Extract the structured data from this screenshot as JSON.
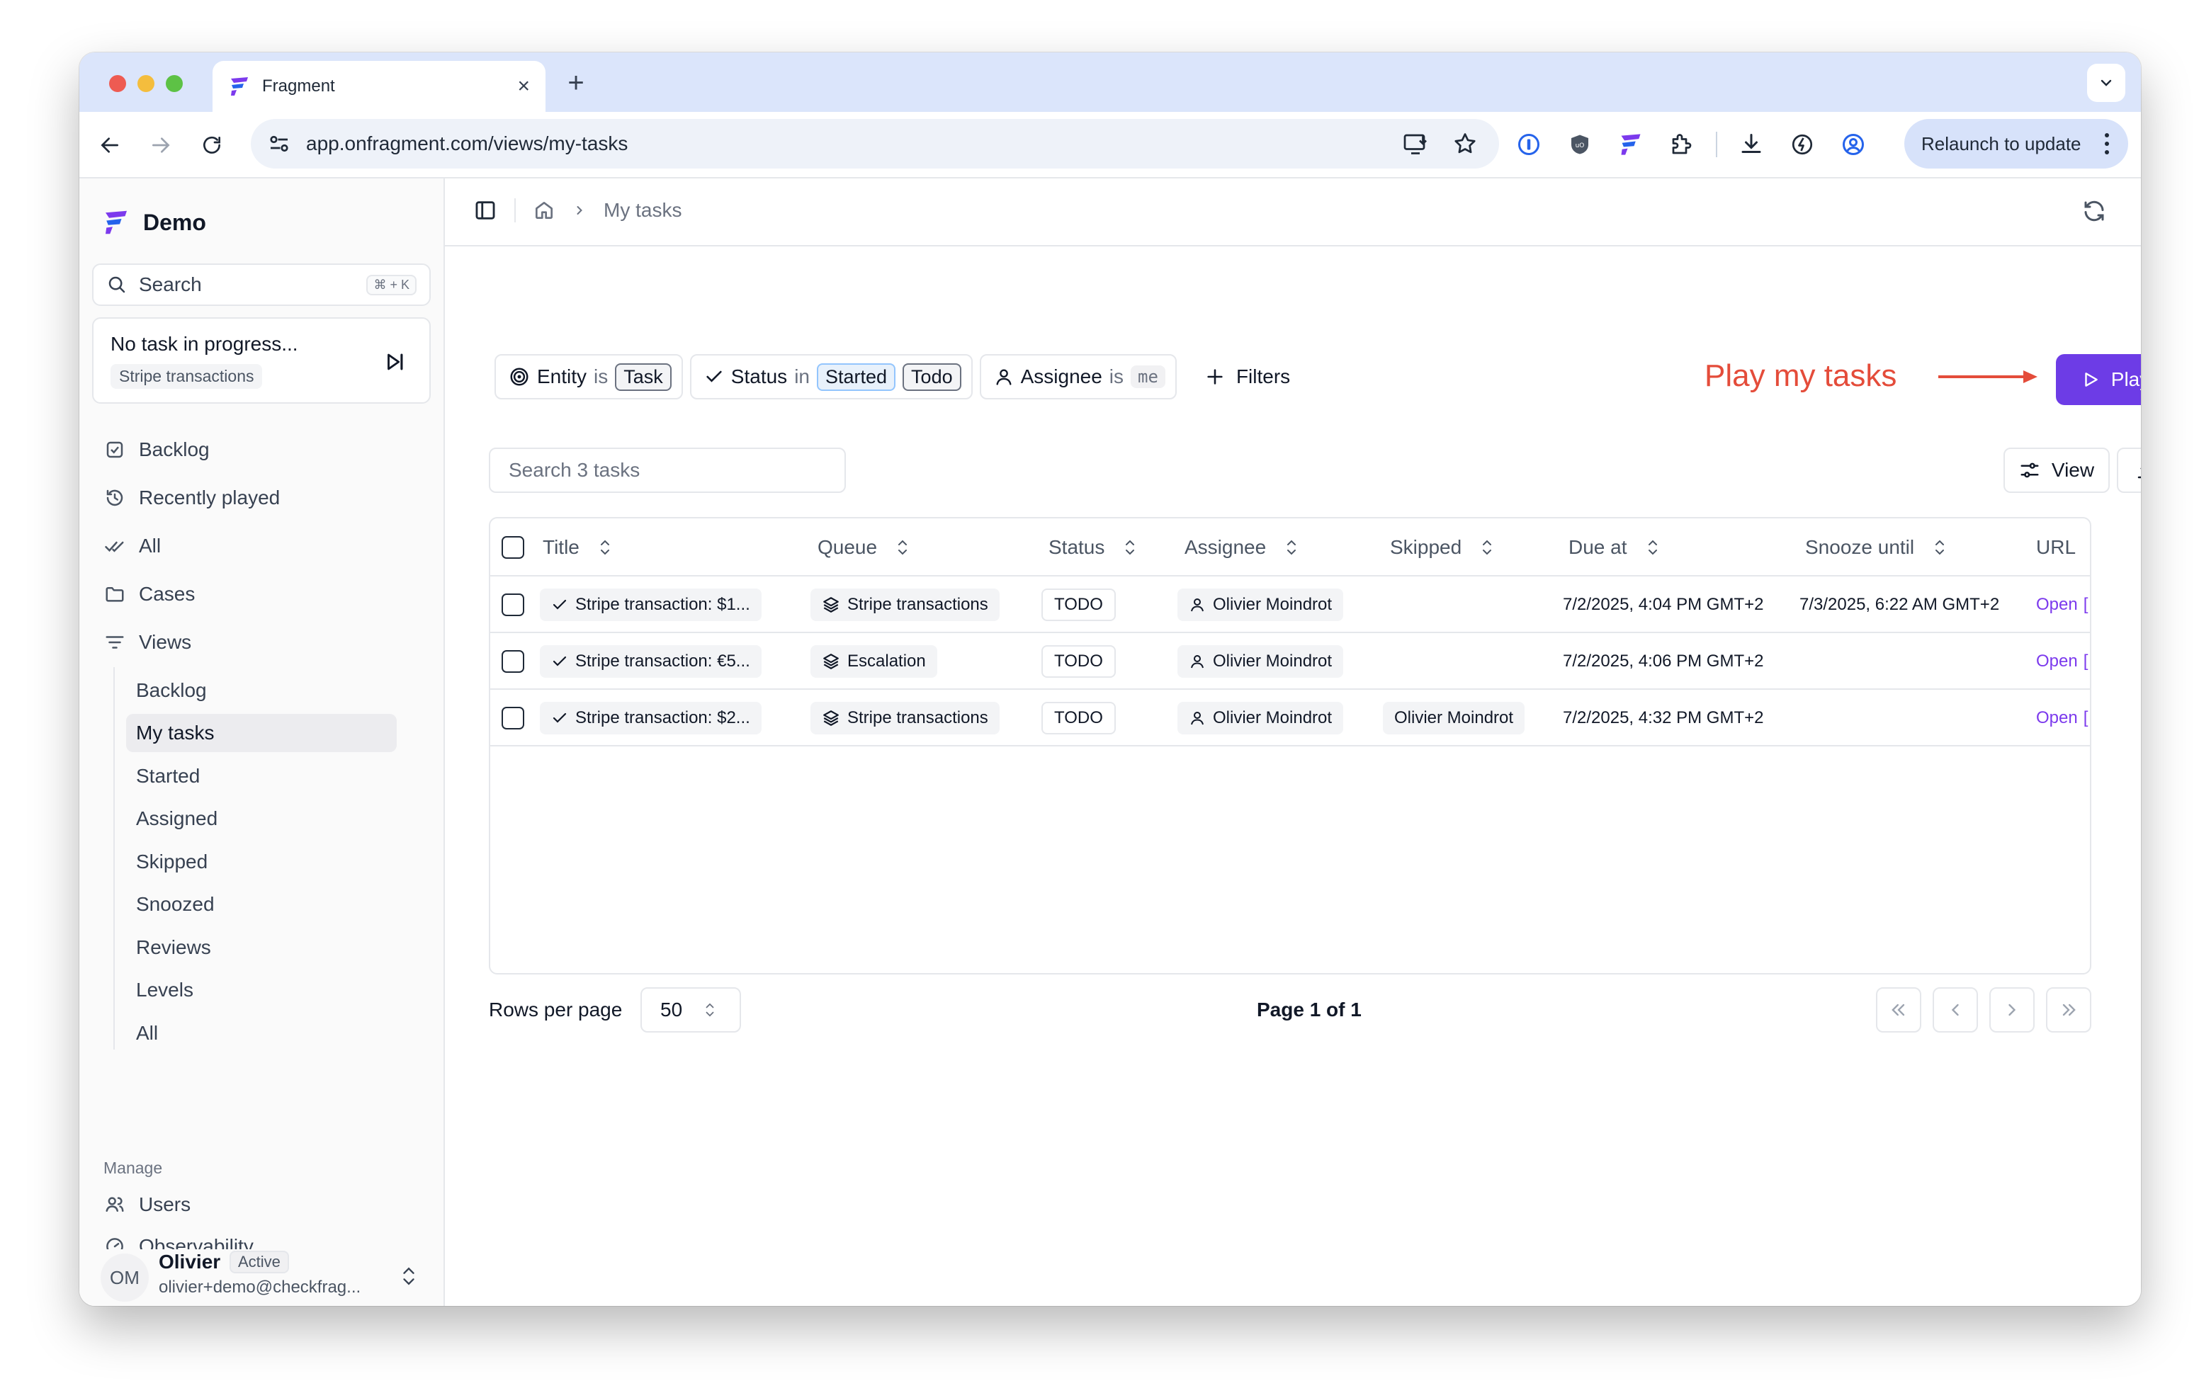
{
  "browser": {
    "tab_title": "Fragment",
    "url": "app.onfragment.com/views/my-tasks",
    "relaunch_label": "Relaunch to update"
  },
  "sidebar": {
    "workspace": "Demo",
    "search_label": "Search",
    "search_shortcut": "⌘ + K",
    "progress_title": "No task in progress...",
    "progress_queue": "Stripe transactions",
    "nav": [
      {
        "label": "Backlog",
        "icon": "checkbox-icon"
      },
      {
        "label": "Recently played",
        "icon": "history-icon"
      },
      {
        "label": "All",
        "icon": "double-check-icon"
      },
      {
        "label": "Cases",
        "icon": "folder-icon"
      },
      {
        "label": "Views",
        "icon": "filter-lines-icon"
      }
    ],
    "views": [
      "Backlog",
      "My tasks",
      "Started",
      "Assigned",
      "Skipped",
      "Snoozed",
      "Reviews",
      "Levels",
      "All"
    ],
    "active_view": "My tasks",
    "manage_label": "Manage",
    "manage": [
      {
        "label": "Users",
        "icon": "users-icon"
      },
      {
        "label": "Observability",
        "icon": "gauge-icon"
      }
    ],
    "user": {
      "initials": "OM",
      "name": "Olivier",
      "status": "Active",
      "email": "olivier+demo@checkfrag..."
    }
  },
  "main": {
    "breadcrumb": "My tasks",
    "filters": {
      "entity": {
        "field": "Entity",
        "op": "is",
        "values": [
          "Task"
        ]
      },
      "status": {
        "field": "Status",
        "op": "in",
        "values": [
          "Started",
          "Todo"
        ]
      },
      "assignee": {
        "field": "Assignee",
        "op": "is",
        "values": [
          "me"
        ]
      },
      "add_label": "Filters"
    },
    "annotation": "Play my tasks",
    "play_label": "Play",
    "search_placeholder": "Search 3 tasks",
    "view_label": "View",
    "columns": [
      "Title",
      "Queue",
      "Status",
      "Assignee",
      "Skipped",
      "Due at",
      "Snooze until",
      "URL"
    ],
    "rows": [
      {
        "title": "Stripe transaction: $1...",
        "queue": "Stripe transactions",
        "status": "TODO",
        "assignee": "Olivier Moindrot",
        "skipped": "",
        "due_at": "7/2/2025, 4:04 PM GMT+2",
        "snooze_until": "7/3/2025, 6:22 AM GMT+2",
        "url": "Open"
      },
      {
        "title": "Stripe transaction: €5...",
        "queue": "Escalation",
        "status": "TODO",
        "assignee": "Olivier Moindrot",
        "skipped": "",
        "due_at": "7/2/2025, 4:06 PM GMT+2",
        "snooze_until": "",
        "url": "Open"
      },
      {
        "title": "Stripe transaction: $2...",
        "queue": "Stripe transactions",
        "status": "TODO",
        "assignee": "Olivier Moindrot",
        "skipped": "Olivier Moindrot",
        "due_at": "7/2/2025, 4:32 PM GMT+2",
        "snooze_until": "",
        "url": "Open"
      }
    ],
    "rows_per_page_label": "Rows per page",
    "rows_per_page": "50",
    "page_info": "Page 1 of 1"
  },
  "colors": {
    "accent": "#6d3ce6",
    "annotation": "#e44c3a",
    "link": "#7c3aed"
  }
}
